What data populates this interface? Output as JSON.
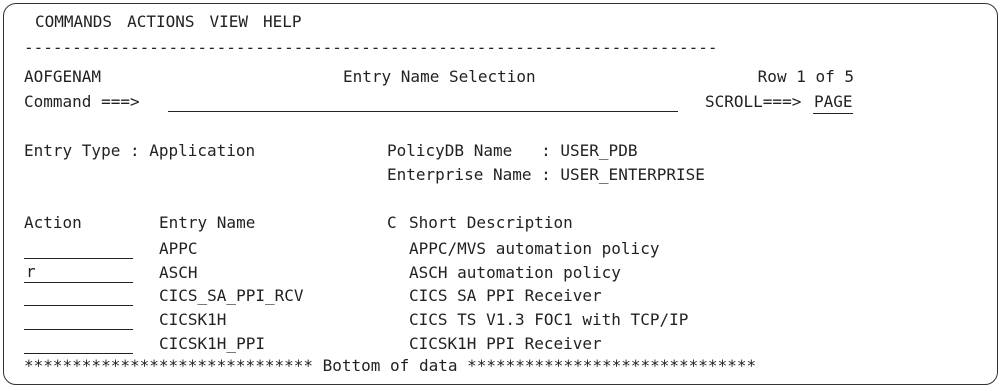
{
  "menu": [
    "COMMANDS",
    "ACTIONS",
    "VIEW",
    "HELP"
  ],
  "separator": "------------------------------------------------------------------------",
  "header": {
    "panel_id": "AOFGENAM",
    "title": "Entry Name Selection",
    "row_info": "Row 1 of 5",
    "command_label": "Command ===>",
    "command_value": "",
    "scroll_label": "SCROLL===>",
    "scroll_value": "PAGE"
  },
  "info": {
    "entry_type": "Entry Type : Application",
    "policydb": "PolicyDB Name   : USER_PDB",
    "enterprise": "Enterprise Name : USER_ENTERPRISE"
  },
  "columns": {
    "action": "Action",
    "entry_name": "Entry Name",
    "c": "C",
    "short_description": "Short Description"
  },
  "rows": [
    {
      "action": "",
      "entry_name": "APPC",
      "c": "",
      "description": "APPC/MVS automation policy"
    },
    {
      "action": "r",
      "entry_name": "ASCH",
      "c": "",
      "description": "ASCH automation policy"
    },
    {
      "action": "",
      "entry_name": "CICS_SA_PPI_RCV",
      "c": "",
      "description": "CICS SA PPI Receiver"
    },
    {
      "action": "",
      "entry_name": "CICSK1H",
      "c": "",
      "description": "CICS TS V1.3 FOC1 with TCP/IP"
    },
    {
      "action": "",
      "entry_name": "CICSK1H_PPI",
      "c": "",
      "description": "CICSK1H PPI Receiver"
    }
  ],
  "bottom": "****************************** Bottom of data ******************************"
}
